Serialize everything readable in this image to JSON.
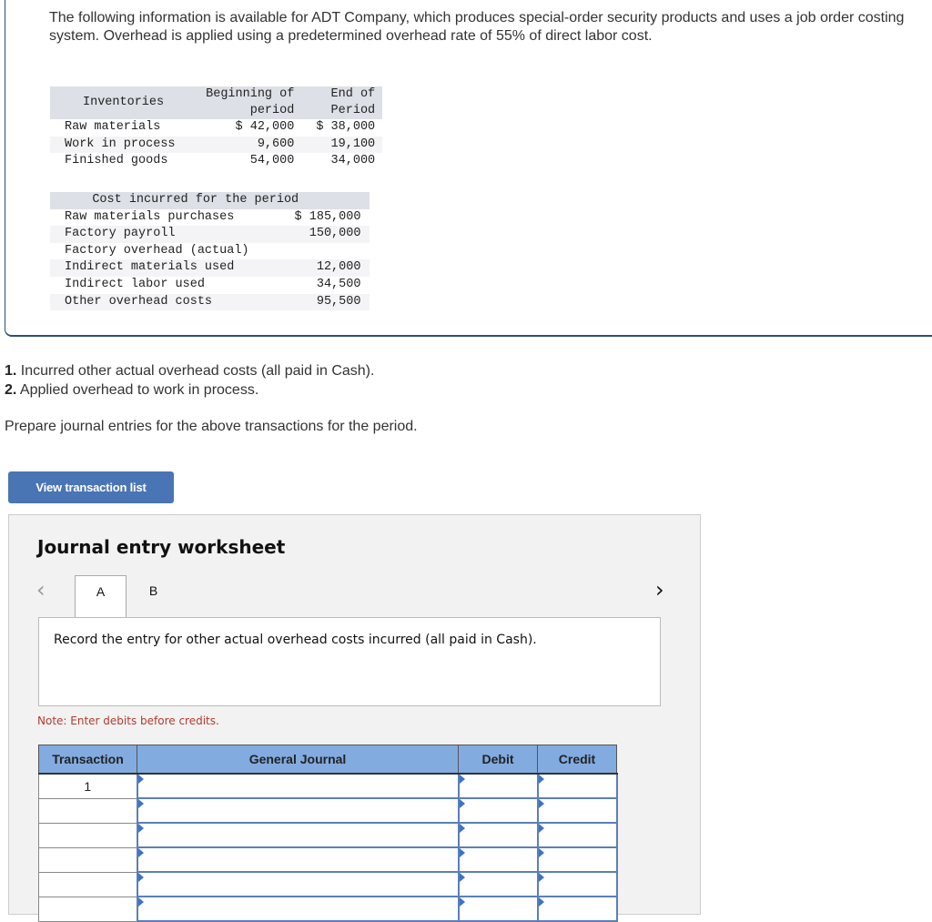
{
  "intro": {
    "text": "The following information is available for ADT Company, which produces special-order security products and uses a job order costing system. Overhead is applied using a predetermined overhead rate of 55% of direct labor cost."
  },
  "inventories": {
    "header": {
      "label": "Inventories",
      "beginning": "Beginning of\nperiod",
      "end": "End of\nPeriod"
    },
    "rows": [
      {
        "label": "Raw materials",
        "beginning": "$ 42,000",
        "end": "$ 38,000"
      },
      {
        "label": "Work in process",
        "beginning": "9,600",
        "end": "19,100"
      },
      {
        "label": "Finished goods",
        "beginning": "54,000",
        "end": "34,000"
      }
    ]
  },
  "costs": {
    "header": "Cost incurred for the period",
    "rows": [
      {
        "label": "Raw materials purchases",
        "value": "$ 185,000"
      },
      {
        "label": "Factory payroll",
        "value": "150,000"
      },
      {
        "label": "Factory overhead (actual)",
        "value": ""
      },
      {
        "label": "Indirect materials used",
        "value": "12,000"
      },
      {
        "label": "Indirect labor used",
        "value": "34,500"
      },
      {
        "label": "Other overhead costs",
        "value": "95,500"
      }
    ]
  },
  "steps": [
    {
      "num": "1.",
      "text": " Incurred other actual overhead costs (all paid in Cash)."
    },
    {
      "num": "2.",
      "text": " Applied overhead to work in process."
    }
  ],
  "prepare_text": "Prepare journal entries for the above transactions for the period.",
  "view_button": "View transaction list",
  "worksheet": {
    "title": "Journal entry worksheet",
    "tabs": [
      "A",
      "B"
    ],
    "prev_icon": "‹",
    "next_icon": "›",
    "prompt": "Record the entry for other actual overhead costs incurred (all paid in Cash).",
    "note": "Note: Enter debits before credits.",
    "table": {
      "headers": [
        "Transaction",
        "General Journal",
        "Debit",
        "Credit"
      ],
      "rows": [
        {
          "transaction": "1",
          "account": "",
          "debit": "",
          "credit": ""
        },
        {
          "transaction": "",
          "account": "",
          "debit": "",
          "credit": ""
        },
        {
          "transaction": "",
          "account": "",
          "debit": "",
          "credit": ""
        },
        {
          "transaction": "",
          "account": "",
          "debit": "",
          "credit": ""
        },
        {
          "transaction": "",
          "account": "",
          "debit": "",
          "credit": ""
        },
        {
          "transaction": "",
          "account": "",
          "debit": "",
          "credit": ""
        }
      ]
    }
  },
  "colors": {
    "button": "#4a75b5",
    "table_header": "#82abe0",
    "note": "#b23a2e",
    "frame": "#2b4f7a"
  }
}
